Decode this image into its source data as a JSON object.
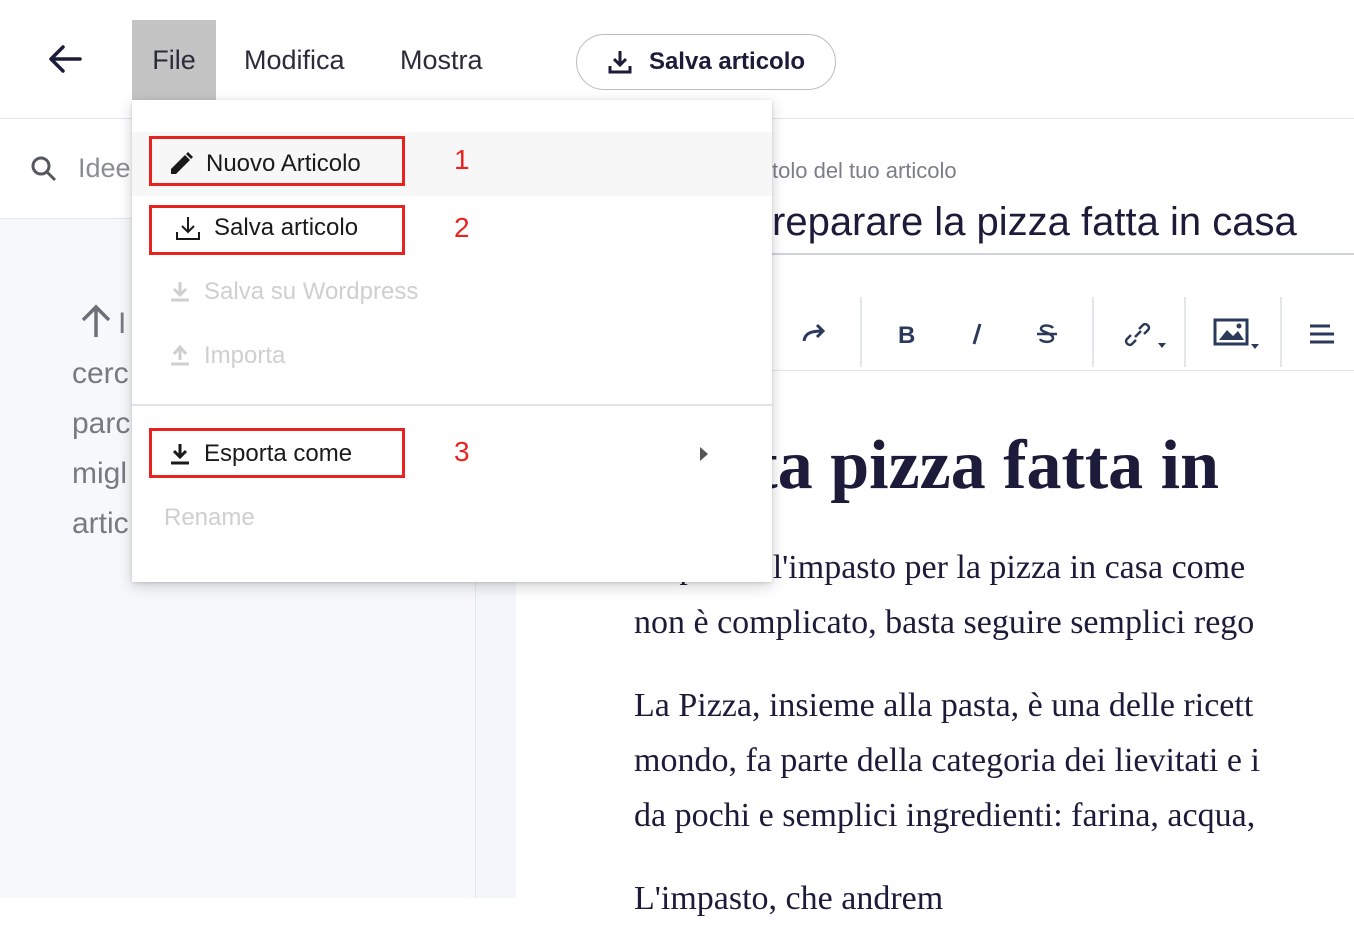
{
  "header": {
    "menus": [
      {
        "label": "File"
      },
      {
        "label": "Modifica"
      },
      {
        "label": "Mostra"
      }
    ],
    "save_button_label": "Salva articolo"
  },
  "sidebar": {
    "search_placeholder": "Idee",
    "hint_lines": [
      "I",
      "cerc",
      "parc",
      "migl",
      "artic"
    ]
  },
  "editor": {
    "title_label": "tolo del tuo articolo",
    "title_value": "reparare la pizza fatta in casa",
    "heading": "etta pizza fatta in",
    "paragraphs": [
      [
        "Preparare l'impasto per la pizza in casa come",
        "non è complicato, basta seguire semplici rego"
      ],
      [
        "La Pizza, insieme alla pasta, è una delle ricett",
        "mondo, fa parte della categoria dei lievitati e i",
        "da pochi e semplici ingredienti: farina, acqua,"
      ],
      [
        "L'impasto, che andrem"
      ]
    ]
  },
  "file_menu": {
    "items": [
      {
        "label": "Nuovo Articolo",
        "icon": "pencil-icon",
        "disabled": false
      },
      {
        "label": "Salva articolo",
        "icon": "download-tray-icon",
        "disabled": false
      },
      {
        "label": "Salva su Wordpress",
        "icon": "download-icon",
        "disabled": true
      },
      {
        "label": "Importa",
        "icon": "upload-icon",
        "disabled": true
      },
      {
        "label": "Esporta come",
        "icon": "download-icon",
        "disabled": false,
        "submenu": true
      },
      {
        "label": "Rename",
        "icon": "",
        "disabled": true
      }
    ],
    "annotations": [
      "1",
      "2",
      "3"
    ]
  },
  "colors": {
    "accent_red": "#e8231f",
    "navy": "#1c1b3a",
    "file_tab_bg": "#c4c4c4"
  }
}
